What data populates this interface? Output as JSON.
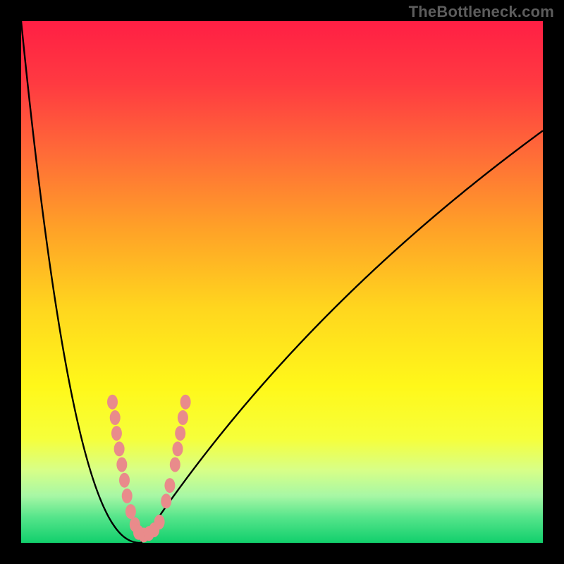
{
  "watermark": "TheBottleneck.com",
  "colors": {
    "gradient_stops": [
      {
        "offset": 0.0,
        "color": "#ff1f44"
      },
      {
        "offset": 0.12,
        "color": "#ff3a41"
      },
      {
        "offset": 0.25,
        "color": "#ff6a38"
      },
      {
        "offset": 0.4,
        "color": "#ffa227"
      },
      {
        "offset": 0.55,
        "color": "#ffd61e"
      },
      {
        "offset": 0.7,
        "color": "#fff81a"
      },
      {
        "offset": 0.8,
        "color": "#f6ff3a"
      },
      {
        "offset": 0.86,
        "color": "#d8ff87"
      },
      {
        "offset": 0.91,
        "color": "#a7f7a5"
      },
      {
        "offset": 0.95,
        "color": "#57e58b"
      },
      {
        "offset": 1.0,
        "color": "#11cf6c"
      }
    ],
    "curve": "#000000",
    "marker_fill": "#e98b8b",
    "marker_stroke": "#d87474"
  },
  "chart_data": {
    "type": "line",
    "title": "",
    "xlabel": "",
    "ylabel": "",
    "x_range": [
      0,
      100
    ],
    "y_range": [
      0,
      100
    ],
    "curve_min_x": 23,
    "left_top_y": 100,
    "right_end": {
      "x": 100,
      "y": 79
    },
    "left_exponent": 2.3,
    "right_scale": 110,
    "series": [
      {
        "name": "bottleneck-curve",
        "kind": "curve",
        "note": "piecewise – rendered by script from parameters above"
      },
      {
        "name": "sample-markers",
        "kind": "scatter",
        "points": [
          {
            "x": 17.5,
            "y": 27
          },
          {
            "x": 18.0,
            "y": 24
          },
          {
            "x": 18.3,
            "y": 21
          },
          {
            "x": 18.8,
            "y": 18
          },
          {
            "x": 19.3,
            "y": 15
          },
          {
            "x": 19.8,
            "y": 12
          },
          {
            "x": 20.3,
            "y": 9
          },
          {
            "x": 21.0,
            "y": 6
          },
          {
            "x": 21.8,
            "y": 3.5
          },
          {
            "x": 22.5,
            "y": 2
          },
          {
            "x": 23.5,
            "y": 1.5
          },
          {
            "x": 24.5,
            "y": 1.8
          },
          {
            "x": 25.5,
            "y": 2.5
          },
          {
            "x": 26.5,
            "y": 4
          },
          {
            "x": 27.8,
            "y": 8
          },
          {
            "x": 28.5,
            "y": 11
          },
          {
            "x": 29.5,
            "y": 15
          },
          {
            "x": 30.0,
            "y": 18
          },
          {
            "x": 30.5,
            "y": 21
          },
          {
            "x": 31.0,
            "y": 24
          },
          {
            "x": 31.5,
            "y": 27
          }
        ]
      }
    ]
  }
}
